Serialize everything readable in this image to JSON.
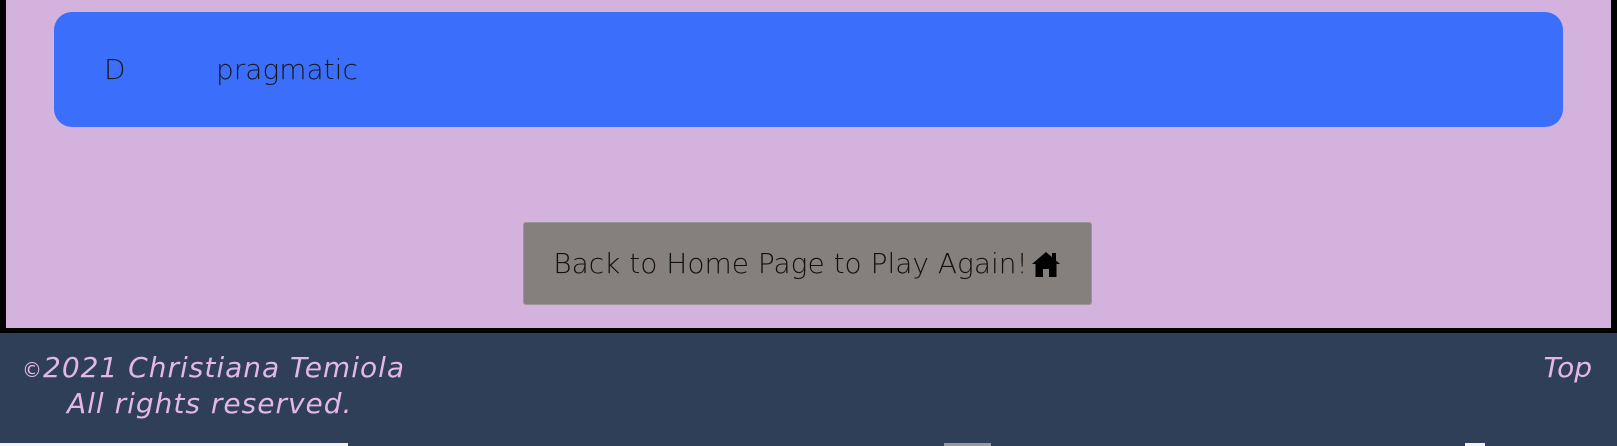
{
  "answer": {
    "letter": "D",
    "text": "pragmatic"
  },
  "home_button": {
    "label": "Back to Home Page to Play Again!",
    "icon": "home-icon"
  },
  "footer": {
    "copyright_symbol": "©",
    "copyright_text": "2021 Christiana Temiola",
    "rights_text": "All rights reserved.",
    "top_link": "Top"
  },
  "colors": {
    "page_background": "#d3b3dd",
    "answer_background": "#3a6efb",
    "button_background": "#857f7e",
    "footer_background": "#2f3f57",
    "footer_text": "#e3b7ea"
  }
}
